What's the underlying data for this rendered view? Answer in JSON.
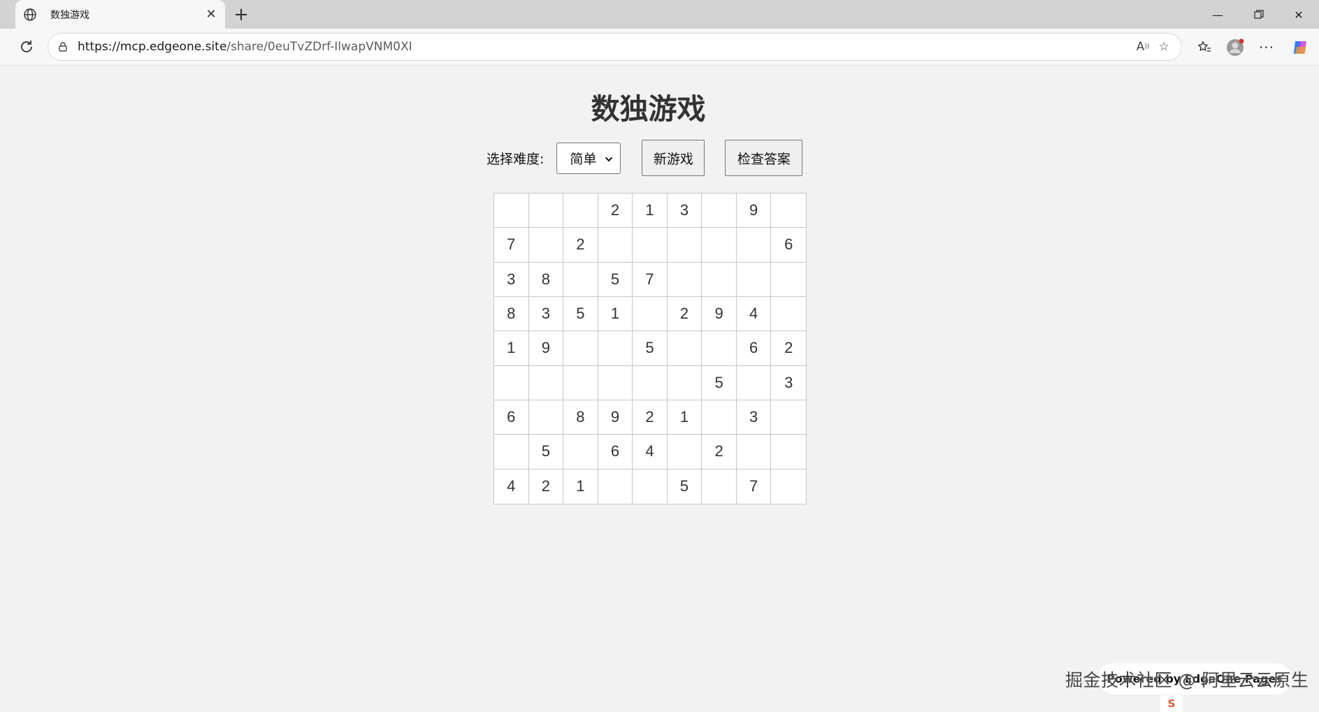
{
  "browser": {
    "tab_title": "数独游戏",
    "url_host": "https://mcp.edgeone.site",
    "url_path": "/share/0euTvZDrf-IlwapVNM0XI",
    "window_buttons": [
      "minimize-icon",
      "restore-icon",
      "close-icon"
    ]
  },
  "page": {
    "title": "数独游戏",
    "difficulty_label": "选择难度:",
    "difficulty_selected": "简单",
    "new_game_label": "新游戏",
    "check_answer_label": "检查答案"
  },
  "board": [
    [
      "",
      "",
      "",
      "2",
      "1",
      "3",
      "",
      "9",
      ""
    ],
    [
      "7",
      "",
      "2",
      "",
      "",
      "",
      "",
      "",
      "6"
    ],
    [
      "3",
      "8",
      "",
      "5",
      "7",
      "",
      "",
      "",
      ""
    ],
    [
      "8",
      "3",
      "5",
      "1",
      "",
      "2",
      "9",
      "4",
      ""
    ],
    [
      "1",
      "9",
      "",
      "",
      "5",
      "",
      "",
      "6",
      "2"
    ],
    [
      "",
      "",
      "",
      "",
      "",
      "",
      "5",
      "",
      "3"
    ],
    [
      "6",
      "",
      "8",
      "9",
      "2",
      "1",
      "",
      "3",
      ""
    ],
    [
      "",
      "5",
      "",
      "6",
      "4",
      "",
      "2",
      "",
      ""
    ],
    [
      "4",
      "2",
      "1",
      "",
      "",
      "5",
      "",
      "7",
      ""
    ]
  ],
  "footer": {
    "powered_by": "Powered by EdgeOne Pages",
    "watermark": "掘金技术社区 @ 阿里云云原生"
  },
  "colors": {
    "page_bg": "#f2f2f2",
    "chrome_bg": "#d3d3d3",
    "cell_text": "#333333",
    "grid_line": "#c6c6c6"
  }
}
